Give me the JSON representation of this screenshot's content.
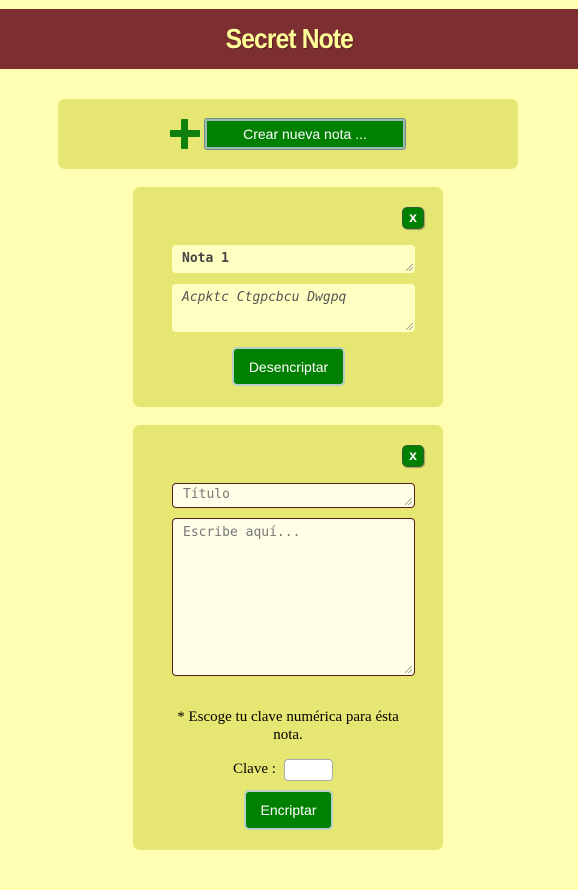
{
  "header": {
    "title": "Secret Note"
  },
  "toolbar": {
    "create_label": "Crear nueva nota ..."
  },
  "notes": [
    {
      "close_label": "x",
      "title": "Nota 1",
      "body": "Acpktc Ctgpcbcu Dwgpq",
      "action_label": "Desencriptar"
    },
    {
      "close_label": "x",
      "title_placeholder": "Título",
      "body_placeholder": "Escribe aquí...",
      "hint": "* Escoge tu clave numérica para ésta nota.",
      "key_label": "Clave :",
      "action_label": "Encriptar"
    }
  ],
  "colors": {
    "background": "#ffffb3",
    "header": "#7d2e31",
    "header_text": "#ffff99",
    "panel": "#e6e673",
    "button": "#008000"
  }
}
